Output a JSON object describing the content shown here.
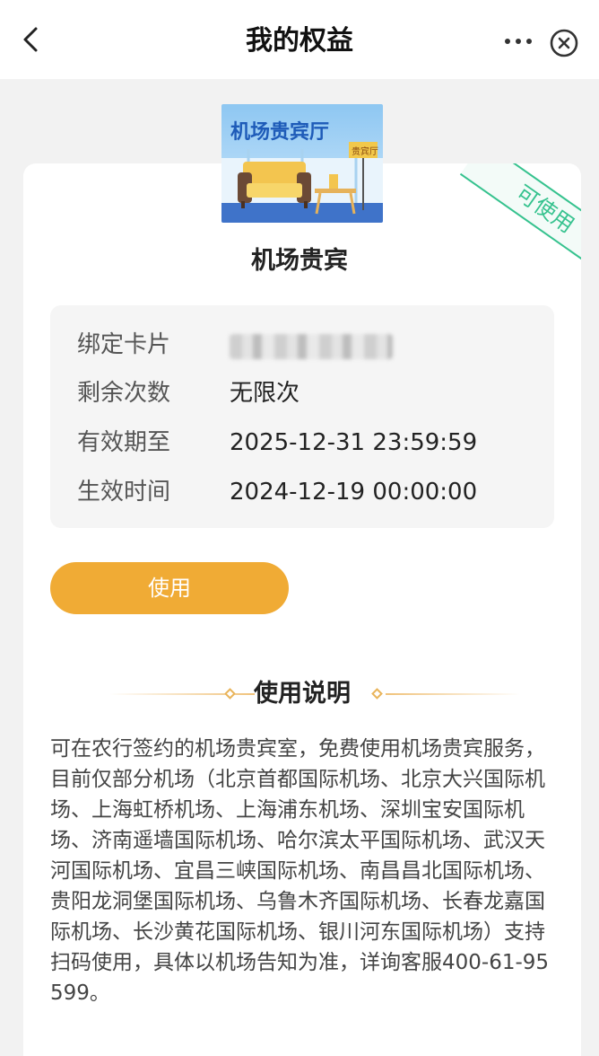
{
  "navbar": {
    "title": "我的权益",
    "back_icon": "chevron-left-icon",
    "more_icon": "more-dots-icon",
    "close_icon": "close-circle-icon"
  },
  "benefit": {
    "image_title": "机场贵宾厅",
    "image_badge": "贵宾厅",
    "name": "机场贵宾",
    "status_badge": "可使用",
    "status_color": "#35c28e"
  },
  "info": {
    "card_label": "绑定卡片",
    "remaining_label": "剩余次数",
    "remaining_value": "无限次",
    "expiry_label": "有效期至",
    "expiry_value": "2025-12-31 23:59:59",
    "effective_label": "生效时间",
    "effective_value": "2024-12-19 00:00:00"
  },
  "actions": {
    "use_label": "使用",
    "use_color": "#f0ab35"
  },
  "instructions": {
    "title": "使用说明",
    "text": "可在农行签约的机场贵宾室，免费使用机场贵宾服务，目前仅部分机场（北京首都国际机场、北京大兴国际机场、上海虹桥机场、上海浦东机场、深圳宝安国际机场、济南遥墙国际机场、哈尔滨太平国际机场、武汉天河国际机场、宜昌三峡国际机场、南昌昌北国际机场、贵阳龙洞堡国际机场、乌鲁木齐国际机场、长春龙嘉国际机场、长沙黄花国际机场、银川河东国际机场）支持扫码使用，具体以机场告知为准，详询客服400-61-95599。"
  }
}
